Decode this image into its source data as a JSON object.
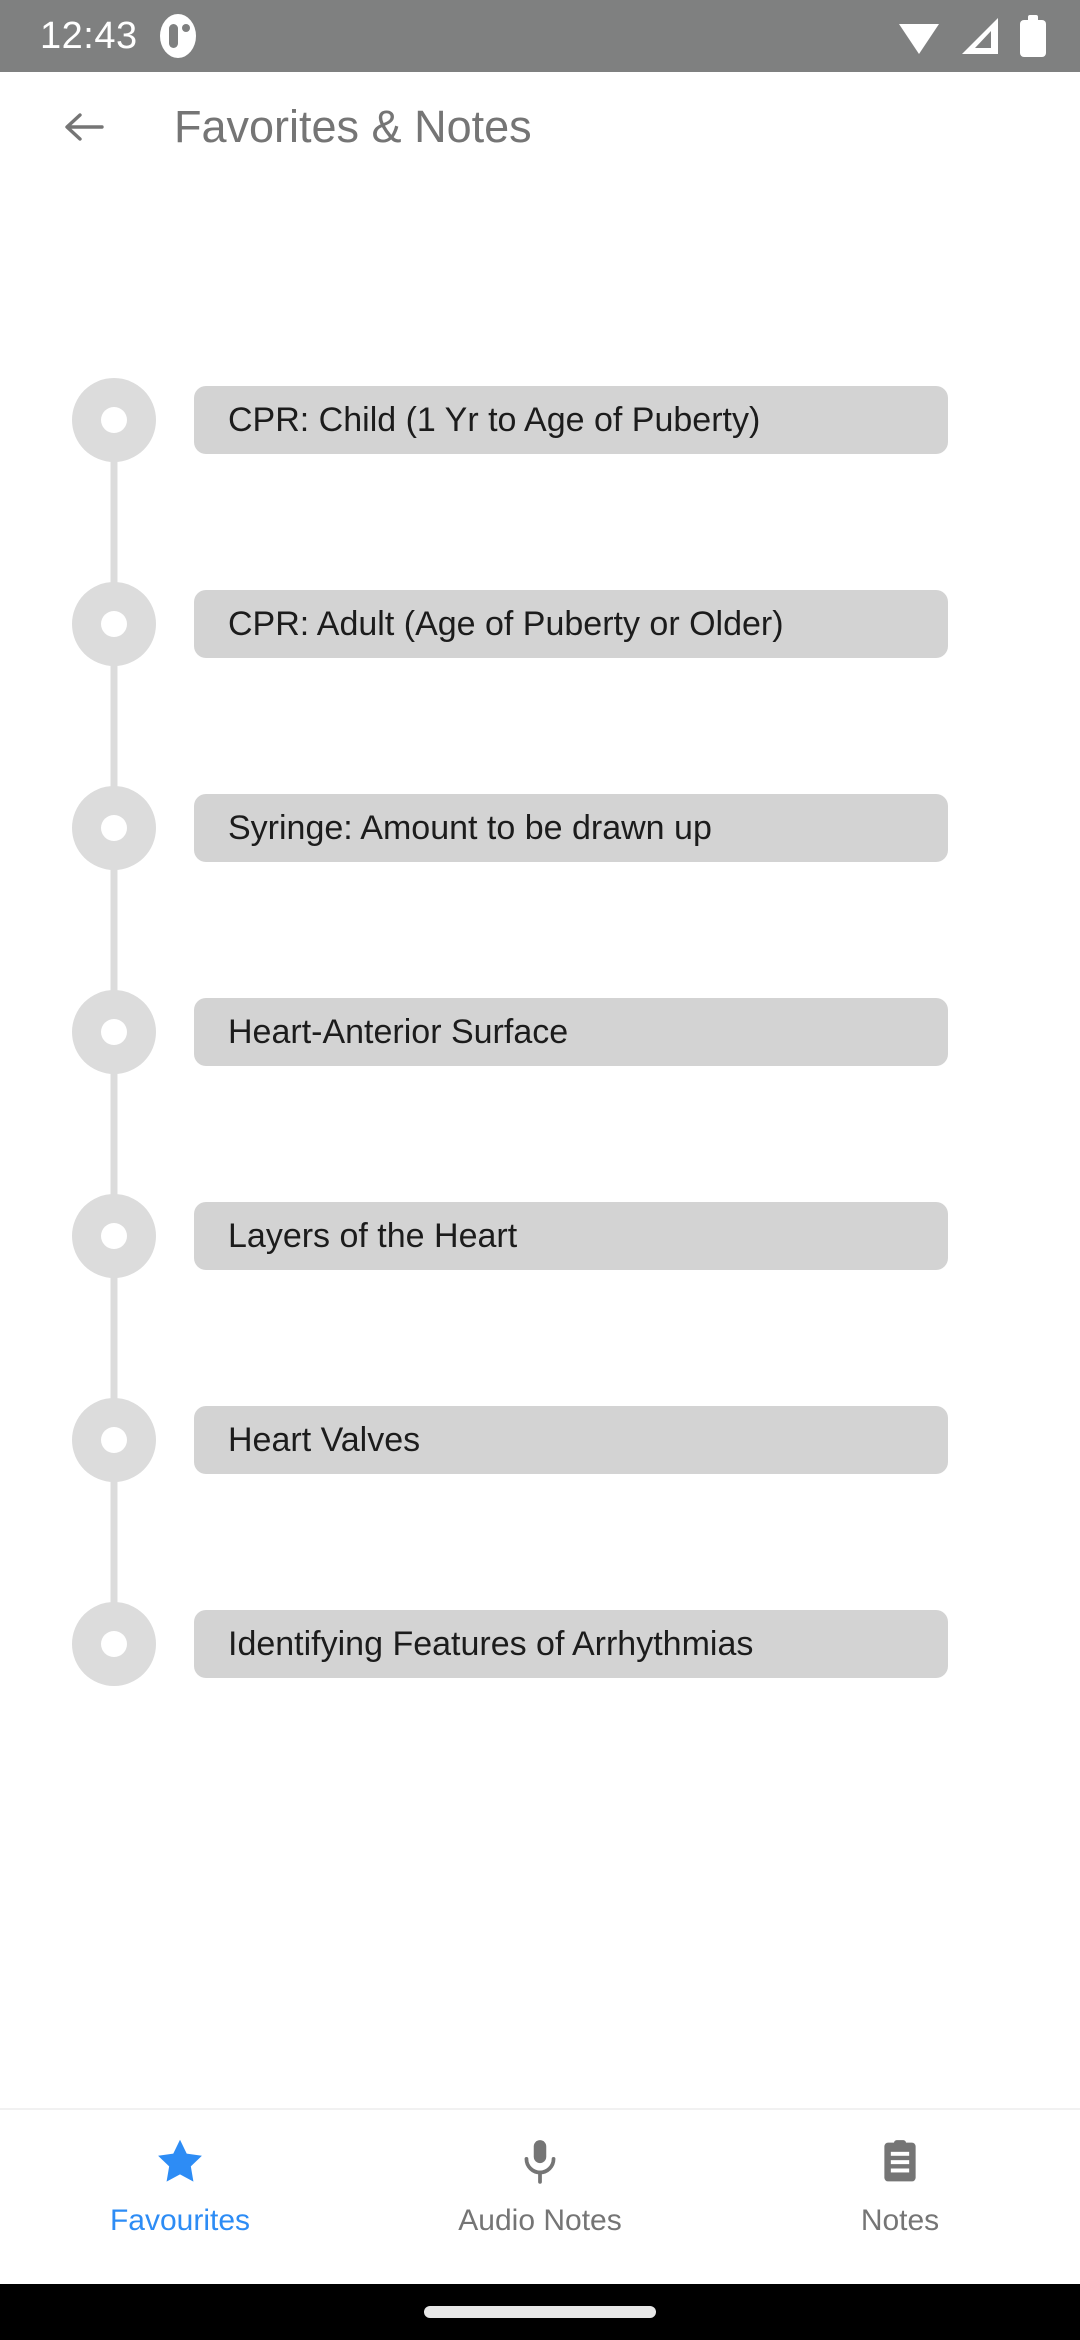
{
  "status_bar": {
    "time": "12:43",
    "notification_icon": "app-notification-icon",
    "wifi_icon": "wifi-icon",
    "signal_icon": "cellular-signal-icon",
    "battery_icon": "battery-icon",
    "background_color": "#7f8080"
  },
  "app_bar": {
    "back_icon": "back-arrow-icon",
    "title": "Favorites & Notes",
    "title_color": "#757575"
  },
  "timeline": {
    "line_color": "#dcdcdc",
    "pill_color": "#d3d3d3",
    "items": [
      {
        "label": "CPR: Child (1 Yr to Age of Puberty)"
      },
      {
        "label": "CPR: Adult (Age of Puberty or Older)"
      },
      {
        "label": "Syringe: Amount to be drawn up"
      },
      {
        "label": "Heart-Anterior Surface"
      },
      {
        "label": "Layers of the Heart"
      },
      {
        "label": "Heart Valves"
      },
      {
        "label": "Identifying Features of Arrhythmias"
      }
    ]
  },
  "bottom_nav": {
    "active_color": "#2d8cf5",
    "inactive_color": "#757575",
    "items": [
      {
        "label": "Favourites",
        "icon": "star-icon",
        "active": true
      },
      {
        "label": "Audio Notes",
        "icon": "microphone-icon",
        "active": false
      },
      {
        "label": "Notes",
        "icon": "clipboard-notes-icon",
        "active": false
      }
    ]
  },
  "gesture_bar": {
    "handle": "home-gesture-handle"
  }
}
